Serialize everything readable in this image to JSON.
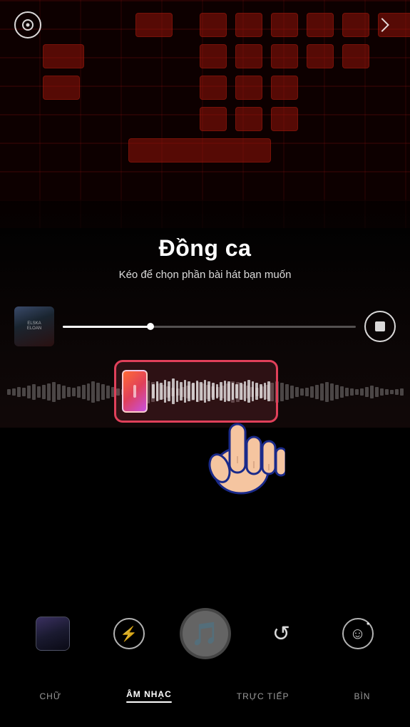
{
  "app": {
    "title": "Đồng ca",
    "subtitle": "Kéo để chọn phần bài hát bạn muốn"
  },
  "track": {
    "album_label_line1": "ELSKA",
    "album_label_line2": "ELOAN"
  },
  "progress": {
    "fill_percent": 30
  },
  "tabs": [
    {
      "id": "chu",
      "label": "CHỮ",
      "active": false
    },
    {
      "id": "am_nhac",
      "label": "ÂM NHẠC",
      "active": true
    },
    {
      "id": "truc_tiep",
      "label": "TRỰC TIẾP",
      "active": false
    },
    {
      "id": "bin",
      "label": "BÌN",
      "active": false
    }
  ],
  "icons": {
    "settings": "⊙",
    "flash": "⚡",
    "music_note": "♪",
    "rotate": "↺",
    "emoji": "☺"
  },
  "colors": {
    "accent": "#e0405a",
    "gradient_start": "#ff6b35",
    "gradient_end": "#c850e0"
  }
}
